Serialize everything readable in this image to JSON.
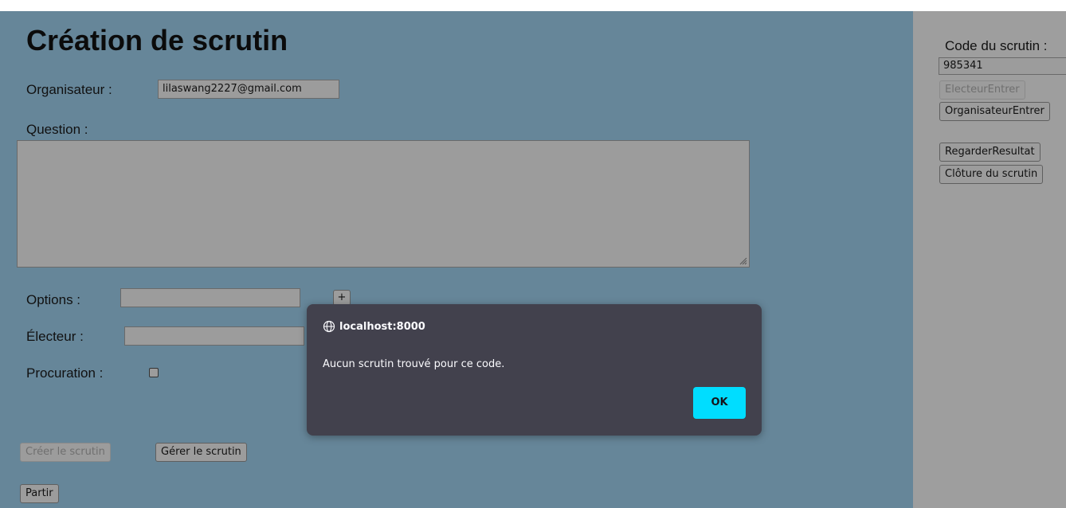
{
  "form": {
    "title": "Création de scrutin",
    "organisateur_label": "Organisateur :",
    "organisateur_value": "lilaswang2227@gmail.com",
    "question_label": "Question :",
    "question_value": "",
    "options_label": "Options :",
    "options_value": "",
    "add_option_label": "+",
    "electeur_label": "Électeur :",
    "electeur_value": "",
    "procuration_label": "Procuration :",
    "procuration_checked": false,
    "creer_label": "Créer le scrutin",
    "gerer_label": "Gérer le scrutin",
    "partir_label": "Partir"
  },
  "side": {
    "code_label": "Code du scrutin :",
    "code_value": "985341",
    "electeur_entrer_label": "ElecteurEntrer",
    "organisateur_entrer_label": "OrganisateurEntrer",
    "regarder_resultat_label": "RegarderResultat",
    "cloture_label": "Clôture du scrutin"
  },
  "dialog": {
    "host": "localhost:8000",
    "message": "Aucun scrutin trouvé pour ce code.",
    "ok_label": "OK",
    "icon": "globe-icon"
  },
  "colors": {
    "main_bg": "#668699",
    "side_bg": "#9e9e9e",
    "dialog_bg": "#42414d",
    "ok_button": "#00ddff"
  }
}
